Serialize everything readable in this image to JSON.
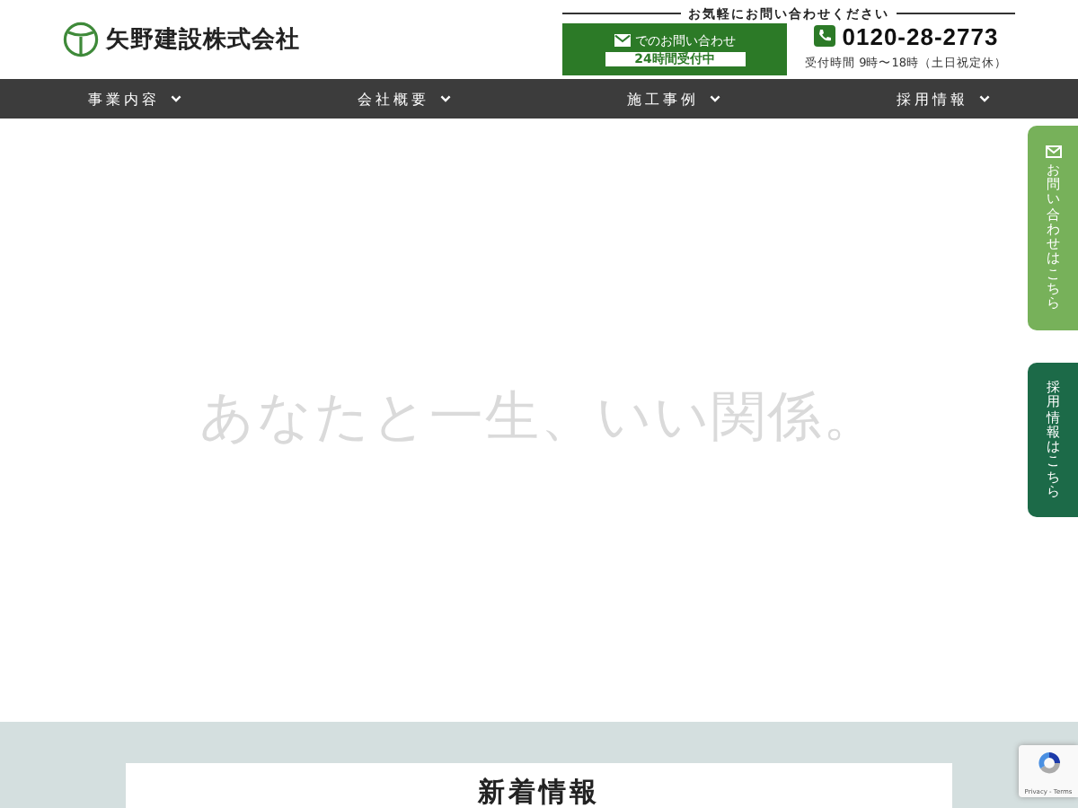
{
  "logo": {
    "company_name": "矢野建設株式会社"
  },
  "contact": {
    "tagline": "お気軽にお問い合わせください",
    "mail_button": {
      "label": "でのお問い合わせ",
      "badge": "24時間受付中"
    },
    "phone": {
      "number": "0120-28-2773",
      "hours": "受付時間 9時〜18時（土日祝定休）"
    }
  },
  "nav": [
    {
      "label": "事業内容"
    },
    {
      "label": "会社概要"
    },
    {
      "label": "施工事例"
    },
    {
      "label": "採用情報"
    }
  ],
  "hero": {
    "catchphrase": "あなたと一生、いい関係。"
  },
  "side_tabs": [
    {
      "kind": "mail",
      "label": "お問い合わせはこちら"
    },
    {
      "kind": "recruit",
      "label": "採用情報はこちら"
    }
  ],
  "news": {
    "heading": "新着情報"
  },
  "recaptcha": {
    "links": "Privacy - Terms"
  }
}
